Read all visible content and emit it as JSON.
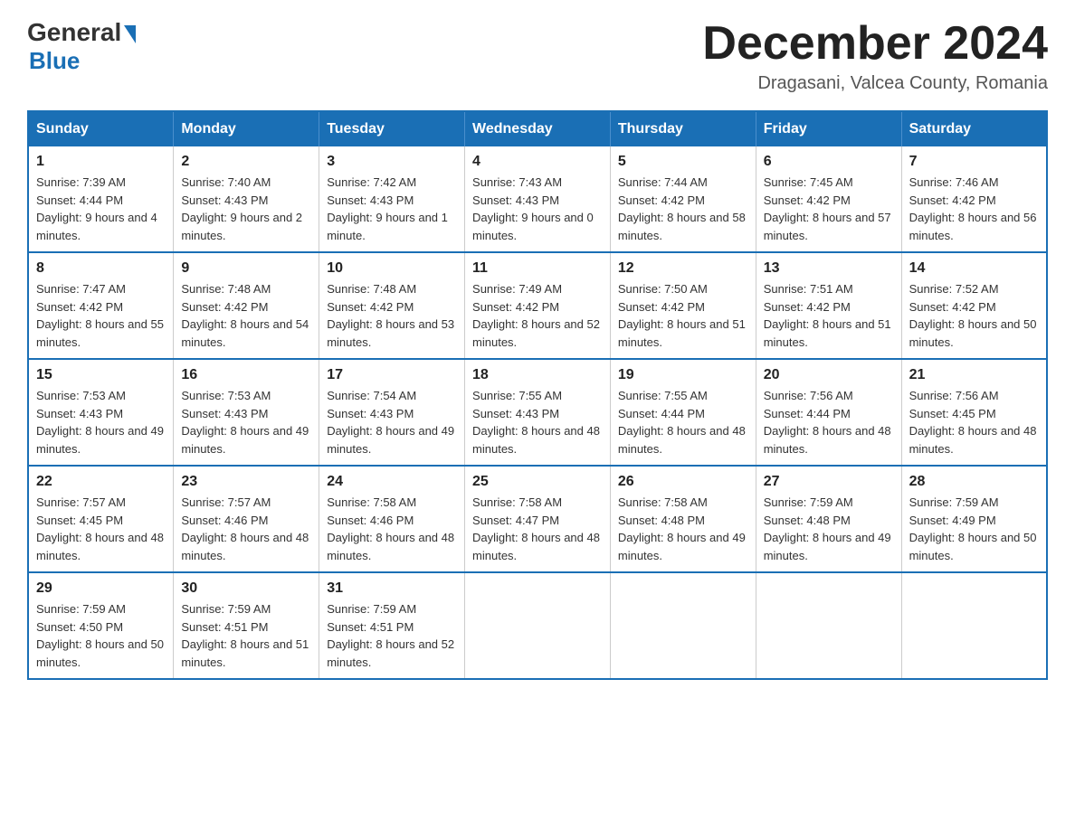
{
  "header": {
    "logo_general": "General",
    "logo_blue": "Blue",
    "month_title": "December 2024",
    "location": "Dragasani, Valcea County, Romania"
  },
  "weekdays": [
    "Sunday",
    "Monday",
    "Tuesday",
    "Wednesday",
    "Thursday",
    "Friday",
    "Saturday"
  ],
  "weeks": [
    [
      {
        "day": "1",
        "sunrise": "7:39 AM",
        "sunset": "4:44 PM",
        "daylight": "9 hours and 4 minutes."
      },
      {
        "day": "2",
        "sunrise": "7:40 AM",
        "sunset": "4:43 PM",
        "daylight": "9 hours and 2 minutes."
      },
      {
        "day": "3",
        "sunrise": "7:42 AM",
        "sunset": "4:43 PM",
        "daylight": "9 hours and 1 minute."
      },
      {
        "day": "4",
        "sunrise": "7:43 AM",
        "sunset": "4:43 PM",
        "daylight": "9 hours and 0 minutes."
      },
      {
        "day": "5",
        "sunrise": "7:44 AM",
        "sunset": "4:42 PM",
        "daylight": "8 hours and 58 minutes."
      },
      {
        "day": "6",
        "sunrise": "7:45 AM",
        "sunset": "4:42 PM",
        "daylight": "8 hours and 57 minutes."
      },
      {
        "day": "7",
        "sunrise": "7:46 AM",
        "sunset": "4:42 PM",
        "daylight": "8 hours and 56 minutes."
      }
    ],
    [
      {
        "day": "8",
        "sunrise": "7:47 AM",
        "sunset": "4:42 PM",
        "daylight": "8 hours and 55 minutes."
      },
      {
        "day": "9",
        "sunrise": "7:48 AM",
        "sunset": "4:42 PM",
        "daylight": "8 hours and 54 minutes."
      },
      {
        "day": "10",
        "sunrise": "7:48 AM",
        "sunset": "4:42 PM",
        "daylight": "8 hours and 53 minutes."
      },
      {
        "day": "11",
        "sunrise": "7:49 AM",
        "sunset": "4:42 PM",
        "daylight": "8 hours and 52 minutes."
      },
      {
        "day": "12",
        "sunrise": "7:50 AM",
        "sunset": "4:42 PM",
        "daylight": "8 hours and 51 minutes."
      },
      {
        "day": "13",
        "sunrise": "7:51 AM",
        "sunset": "4:42 PM",
        "daylight": "8 hours and 51 minutes."
      },
      {
        "day": "14",
        "sunrise": "7:52 AM",
        "sunset": "4:42 PM",
        "daylight": "8 hours and 50 minutes."
      }
    ],
    [
      {
        "day": "15",
        "sunrise": "7:53 AM",
        "sunset": "4:43 PM",
        "daylight": "8 hours and 49 minutes."
      },
      {
        "day": "16",
        "sunrise": "7:53 AM",
        "sunset": "4:43 PM",
        "daylight": "8 hours and 49 minutes."
      },
      {
        "day": "17",
        "sunrise": "7:54 AM",
        "sunset": "4:43 PM",
        "daylight": "8 hours and 49 minutes."
      },
      {
        "day": "18",
        "sunrise": "7:55 AM",
        "sunset": "4:43 PM",
        "daylight": "8 hours and 48 minutes."
      },
      {
        "day": "19",
        "sunrise": "7:55 AM",
        "sunset": "4:44 PM",
        "daylight": "8 hours and 48 minutes."
      },
      {
        "day": "20",
        "sunrise": "7:56 AM",
        "sunset": "4:44 PM",
        "daylight": "8 hours and 48 minutes."
      },
      {
        "day": "21",
        "sunrise": "7:56 AM",
        "sunset": "4:45 PM",
        "daylight": "8 hours and 48 minutes."
      }
    ],
    [
      {
        "day": "22",
        "sunrise": "7:57 AM",
        "sunset": "4:45 PM",
        "daylight": "8 hours and 48 minutes."
      },
      {
        "day": "23",
        "sunrise": "7:57 AM",
        "sunset": "4:46 PM",
        "daylight": "8 hours and 48 minutes."
      },
      {
        "day": "24",
        "sunrise": "7:58 AM",
        "sunset": "4:46 PM",
        "daylight": "8 hours and 48 minutes."
      },
      {
        "day": "25",
        "sunrise": "7:58 AM",
        "sunset": "4:47 PM",
        "daylight": "8 hours and 48 minutes."
      },
      {
        "day": "26",
        "sunrise": "7:58 AM",
        "sunset": "4:48 PM",
        "daylight": "8 hours and 49 minutes."
      },
      {
        "day": "27",
        "sunrise": "7:59 AM",
        "sunset": "4:48 PM",
        "daylight": "8 hours and 49 minutes."
      },
      {
        "day": "28",
        "sunrise": "7:59 AM",
        "sunset": "4:49 PM",
        "daylight": "8 hours and 50 minutes."
      }
    ],
    [
      {
        "day": "29",
        "sunrise": "7:59 AM",
        "sunset": "4:50 PM",
        "daylight": "8 hours and 50 minutes."
      },
      {
        "day": "30",
        "sunrise": "7:59 AM",
        "sunset": "4:51 PM",
        "daylight": "8 hours and 51 minutes."
      },
      {
        "day": "31",
        "sunrise": "7:59 AM",
        "sunset": "4:51 PM",
        "daylight": "8 hours and 52 minutes."
      },
      null,
      null,
      null,
      null
    ]
  ],
  "labels": {
    "sunrise": "Sunrise:",
    "sunset": "Sunset:",
    "daylight": "Daylight:"
  },
  "colors": {
    "header_bg": "#1a6fb5",
    "border": "#1a6fb5"
  }
}
